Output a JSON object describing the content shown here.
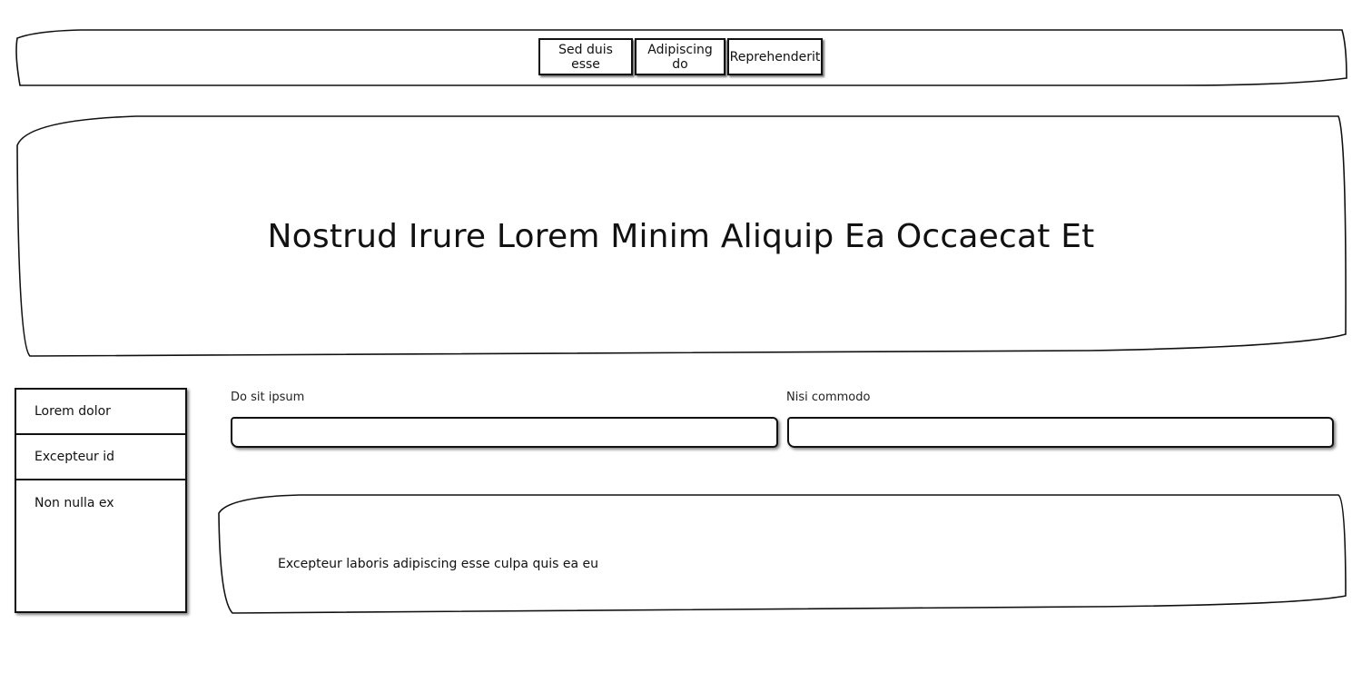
{
  "nav": {
    "items": [
      {
        "label": "Sed duis esse"
      },
      {
        "label": "Adipiscing do"
      },
      {
        "label": "Reprehenderit"
      }
    ]
  },
  "hero": {
    "title": "Nostrud Irure Lorem Minim Aliquip Ea Occaecat Et"
  },
  "sidebar": {
    "items": [
      {
        "label": "Lorem dolor"
      },
      {
        "label": "Excepteur id"
      },
      {
        "label": "Non nulla ex"
      }
    ]
  },
  "form": {
    "field1": {
      "label": "Do sit ipsum",
      "value": "",
      "placeholder": ""
    },
    "field2": {
      "label": "Nisi commodo",
      "value": "",
      "placeholder": ""
    }
  },
  "content": {
    "text": "Excepteur laboris adipiscing esse culpa quis ea eu"
  },
  "colors": {
    "stroke": "#111111",
    "background": "#ffffff"
  }
}
